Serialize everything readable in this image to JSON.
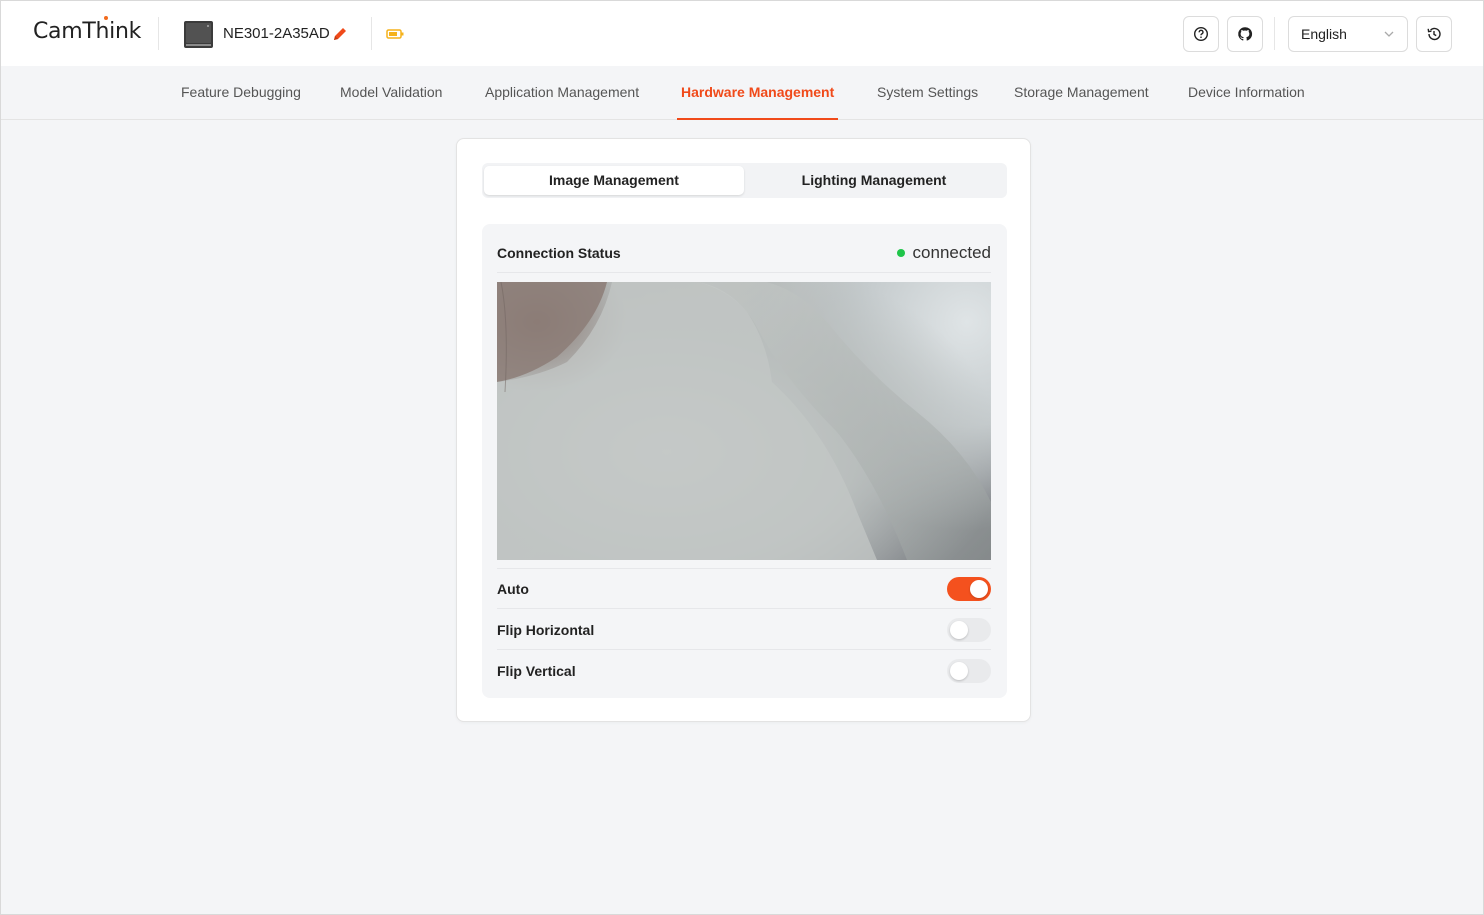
{
  "header": {
    "logo": "CamThink",
    "device_name": "NE301-2A35AD",
    "language": "English"
  },
  "nav": {
    "tabs": [
      {
        "label": "Feature Debugging"
      },
      {
        "label": "Model Validation"
      },
      {
        "label": "Application Management"
      },
      {
        "label": "Hardware Management"
      },
      {
        "label": "System Settings"
      },
      {
        "label": "Storage Management"
      },
      {
        "label": "Device Information"
      }
    ],
    "active": "Hardware Management"
  },
  "card": {
    "segments": [
      {
        "label": "Image Management"
      },
      {
        "label": "Lighting Management"
      }
    ],
    "active_segment": "Image Management",
    "connection": {
      "label": "Connection Status",
      "value": "connected",
      "color": "#1fc54a"
    },
    "settings": [
      {
        "label": "Auto",
        "on": true
      },
      {
        "label": "Flip Horizontal",
        "on": false
      },
      {
        "label": "Flip Vertical",
        "on": false
      }
    ]
  },
  "colors": {
    "accent": "#f04a1a",
    "toggle_on": "#f4511e",
    "status_connected": "#1fc54a"
  }
}
